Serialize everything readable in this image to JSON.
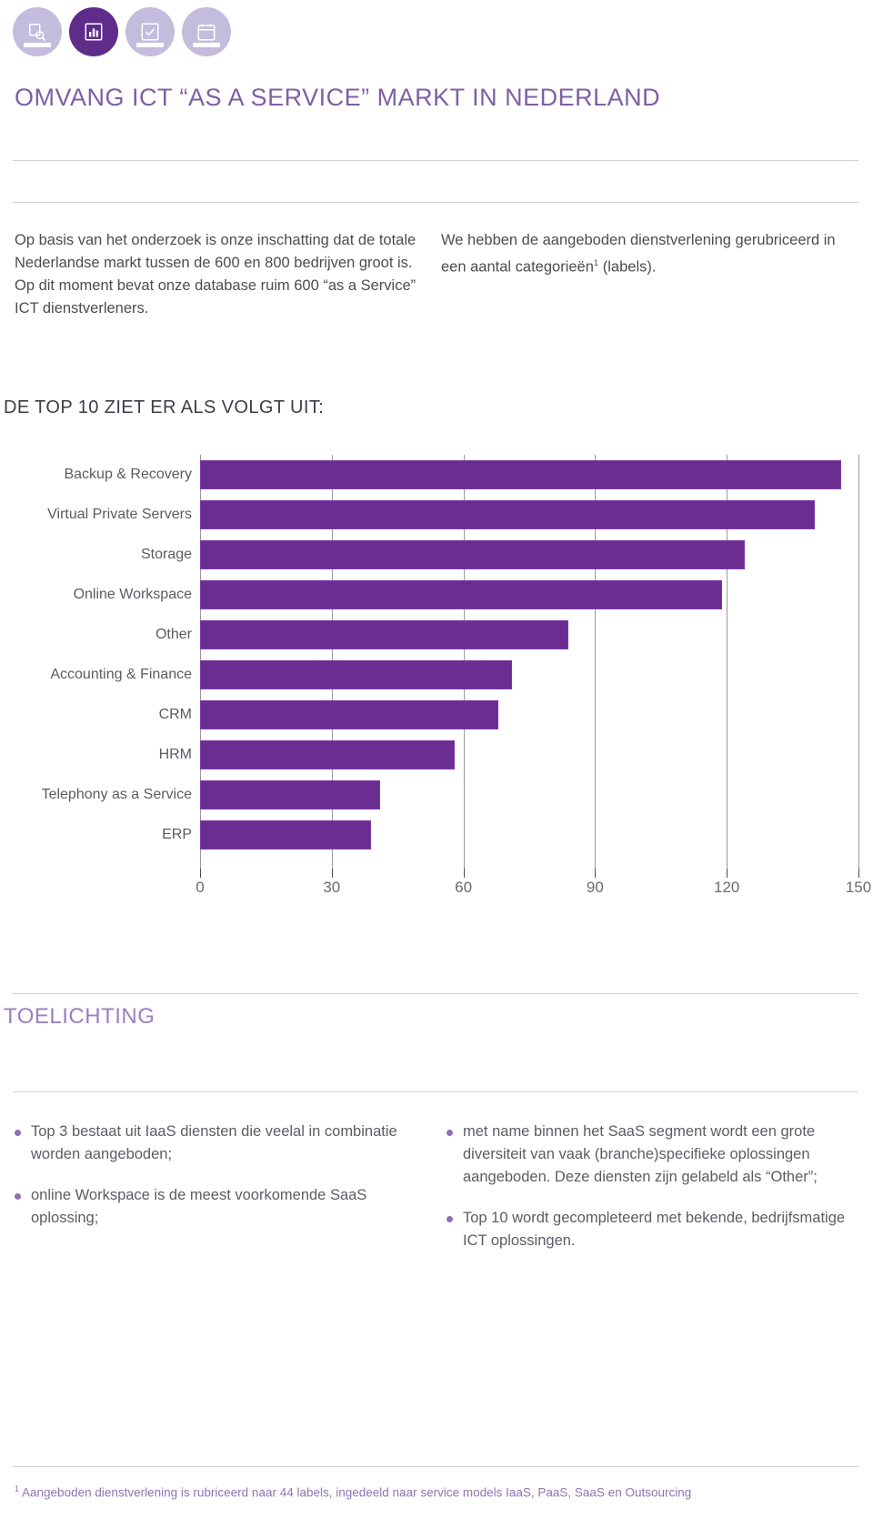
{
  "toolbar": {
    "icons": [
      {
        "name": "document-search-icon",
        "active": false
      },
      {
        "name": "bar-chart-icon",
        "active": true
      },
      {
        "name": "checklist-icon",
        "active": false
      },
      {
        "name": "calendar-icon",
        "active": false
      }
    ]
  },
  "header": {
    "title": "OMVANG ICT “AS A SERVICE” MARKT IN NEDERLAND"
  },
  "intro": {
    "left": "Op basis van het onderzoek is onze inschatting dat de totale Nederlandse markt tussen de 600 en 800 bedrijven groot is. Op dit moment bevat onze database ruim 600 “as a Service” ICT dienstverleners.",
    "right_before": "We hebben de aangeboden dienstverlening gerubriceerd in een aantal categorieën",
    "right_sup": "1",
    "right_after": " (labels)."
  },
  "subhead": "DE TOP 10 ZIET ER ALS VOLGT UIT:",
  "chart_data": {
    "type": "bar",
    "orientation": "horizontal",
    "title": "",
    "xlabel": "",
    "ylabel": "",
    "xlim": [
      0,
      150
    ],
    "grid": true,
    "legend": false,
    "bar_color": "#6b2d91",
    "ticks": [
      0,
      30,
      60,
      90,
      120,
      150
    ],
    "categories": [
      "Backup & Recovery",
      "Virtual Private Servers",
      "Storage",
      "Online Workspace",
      "Other",
      "Accounting & Finance",
      "CRM",
      "HRM",
      "Telephony as a Service",
      "ERP"
    ],
    "values": [
      146,
      140,
      124,
      119,
      84,
      71,
      68,
      58,
      41,
      39
    ]
  },
  "toelichting": {
    "heading": "TOELICHTING"
  },
  "bullets": {
    "left": [
      "Top 3 bestaat uit IaaS diensten die veelal in combinatie worden aangeboden;",
      "online Workspace is de meest voorkomende SaaS oplossing;"
    ],
    "right": [
      "met name binnen het SaaS segment wordt een grote diversiteit van vaak (branche)specifieke oplossingen aangeboden. Deze diensten zijn gelabeld als “Other”;",
      "Top 10 wordt gecompleteerd met bekende, bedrijfsmatige ICT oplossingen."
    ]
  },
  "footnote": {
    "marker": "1",
    "text": " Aangeboden dienstverlening is rubriceerd  naar 44 labels, ingedeeld naar service models IaaS, PaaS, SaaS en Outsourcing"
  }
}
